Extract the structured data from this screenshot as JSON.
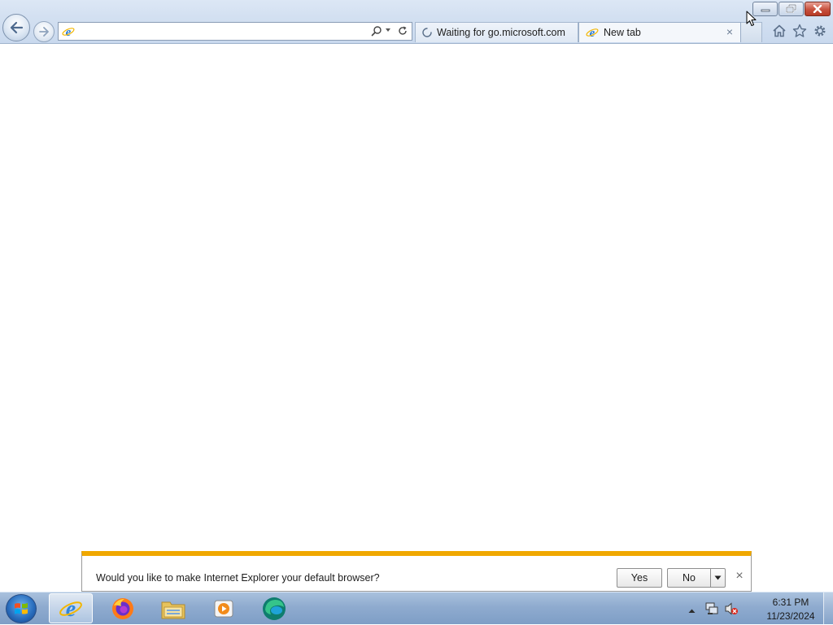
{
  "browser": {
    "address_bar": {
      "value": "",
      "placeholder": ""
    },
    "tabs": [
      {
        "label": "Waiting for go.microsoft.com",
        "icon": "loading-spinner-icon",
        "state": "loading"
      },
      {
        "label": "New tab",
        "icon": "ie-logo-icon",
        "state": "active"
      }
    ],
    "tab_close_label": "×"
  },
  "notification": {
    "message": "Would you like to make Internet Explorer your default browser?",
    "yes_label": "Yes",
    "no_label": "No",
    "close_label": "×",
    "accent_color": "#f0a800"
  },
  "taskbar": {
    "pinned": [
      "ie-logo-icon",
      "firefox-icon",
      "file-explorer-icon",
      "media-player-icon",
      "edge-icon"
    ],
    "clock": {
      "time": "6:31 PM",
      "date": "11/23/2024"
    }
  }
}
